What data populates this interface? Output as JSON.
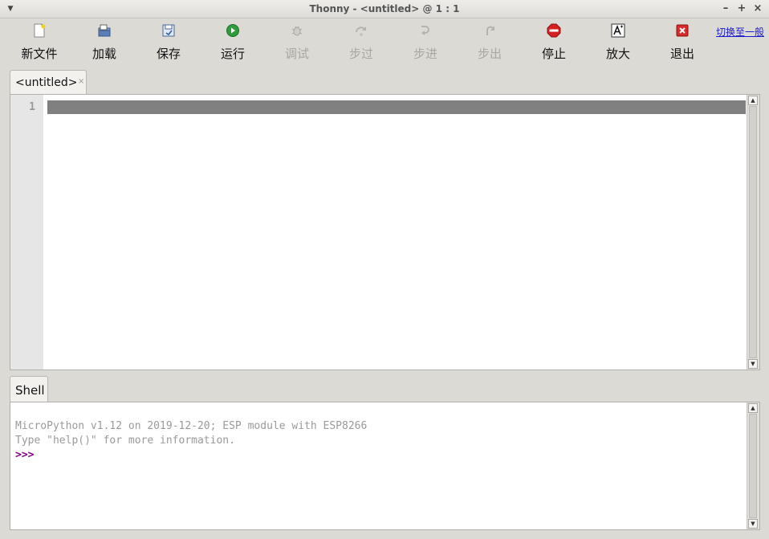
{
  "window": {
    "title": "Thonny  -  <untitled>  @  1 : 1",
    "menu_icon": "chevron-down-icon",
    "controls": {
      "minimize": "–",
      "maximize": "+",
      "close": "×"
    }
  },
  "toolbar": {
    "buttons": [
      {
        "label": "新文件",
        "icon": "new-file-icon",
        "enabled": true
      },
      {
        "label": "加载",
        "icon": "open-folder-icon",
        "enabled": true
      },
      {
        "label": "保存",
        "icon": "save-icon",
        "enabled": true
      },
      {
        "label": "运行",
        "icon": "run-icon",
        "enabled": true
      },
      {
        "label": "调试",
        "icon": "debug-icon",
        "enabled": false
      },
      {
        "label": "步过",
        "icon": "step-over-icon",
        "enabled": false
      },
      {
        "label": "步进",
        "icon": "step-into-icon",
        "enabled": false
      },
      {
        "label": "步出",
        "icon": "step-out-icon",
        "enabled": false
      },
      {
        "label": "停止",
        "icon": "stop-icon",
        "enabled": true
      },
      {
        "label": "放大",
        "icon": "zoom-font-icon",
        "enabled": true
      },
      {
        "label": "退出",
        "icon": "exit-icon",
        "enabled": true
      }
    ],
    "switch_link": "切换至一般"
  },
  "editor": {
    "tab_label": "<untitled>",
    "tab_close": "×",
    "line_numbers": [
      "1"
    ]
  },
  "shell": {
    "tab_label": "Shell",
    "lines": [
      "MicroPython v1.12 on 2019-12-20; ESP module with ESP8266",
      "Type \"help()\" for more information."
    ],
    "prompt": ">>>"
  },
  "colors": {
    "background": "#dcdad5",
    "current_line": "#808080",
    "prompt": "#800080",
    "link": "#1a1acc",
    "run_green": "#2e9c3a",
    "stop_red": "#d42020",
    "exit_red": "#d62a2a"
  }
}
